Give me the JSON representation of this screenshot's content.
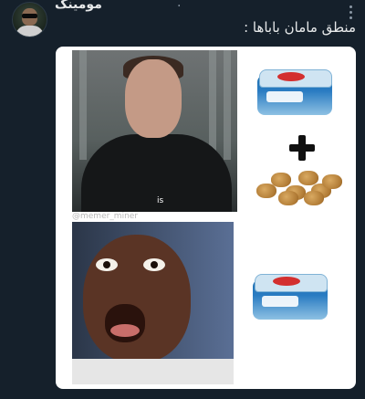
{
  "tweet": {
    "username": "مومینگ",
    "separator": "·",
    "text": "منطق مامان باباها :"
  },
  "meme": {
    "caption": "is",
    "watermark": "@memer_miner"
  },
  "icons": {
    "avatar": "user-avatar",
    "menu": "more-options-icon",
    "plus": "plus-icon"
  },
  "colors": {
    "background": "#15202b",
    "text": "#e7e9ea",
    "muted": "#8b98a5"
  }
}
